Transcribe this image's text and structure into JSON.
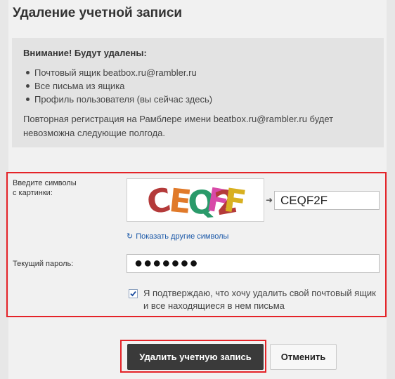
{
  "page": {
    "title": "Удаление учетной записи"
  },
  "warning": {
    "heading": "Внимание! Будут удалены:",
    "items": [
      "Почтовый ящик beatbox.ru@rambler.ru",
      "Все письма из ящика",
      "Профиль пользователя (вы сейчас здесь)"
    ],
    "note": "Повторная регистрация на Рамблере имени beatbox.ru@rambler.ru будет невозможна следующие полгода."
  },
  "form": {
    "captcha_label": "Введите символы\nс картинки:",
    "captcha_image_text": "CEQF2F",
    "captcha_value": "CEQF2F",
    "refresh_link": "Показать другие символы",
    "password_label": "Текущий пароль:",
    "password_value": "●●●●●●●",
    "confirm_checked": true,
    "confirm_text": "Я подтверждаю, что хочу удалить свой почтовый ящик и все находящиеся в нем письма"
  },
  "buttons": {
    "delete_label": "Удалить учетную запись",
    "cancel_label": "Отменить"
  },
  "colors": {
    "highlight": "#e42328",
    "link": "#1a58a8",
    "primary_button": "#3a3a3a"
  }
}
